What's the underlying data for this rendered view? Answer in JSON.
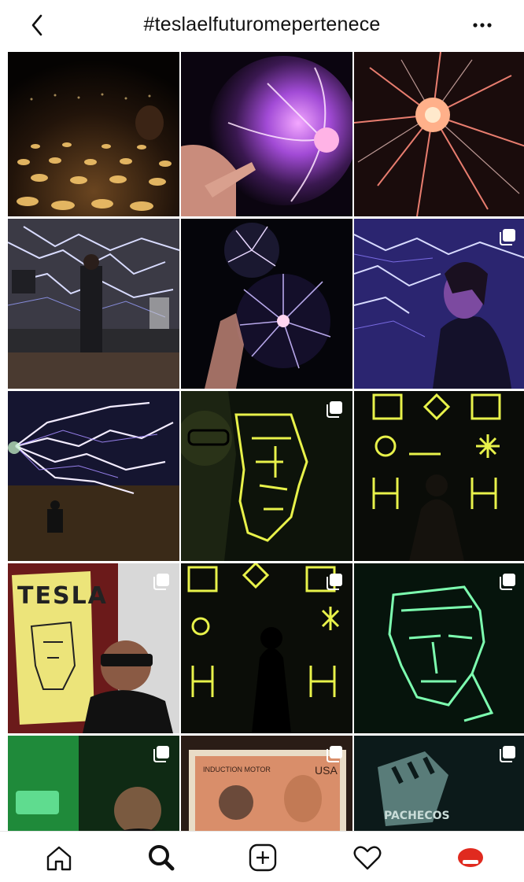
{
  "header": {
    "title": "#teslaelfuturomepertenece",
    "back_icon": "chevron-left-icon",
    "more_icon": "more-horizontal-icon"
  },
  "grid": {
    "posts": [
      {
        "subject": "candles in dark room",
        "multi": false
      },
      {
        "subject": "hand on plasma ball",
        "multi": false
      },
      {
        "subject": "plasma ball red filaments",
        "multi": false
      },
      {
        "subject": "man under tesla coil lightning",
        "multi": false
      },
      {
        "subject": "hands around plasma ball",
        "multi": false
      },
      {
        "subject": "woman under blue lightning",
        "multi": true
      },
      {
        "subject": "lightning over man sitting",
        "multi": false
      },
      {
        "subject": "selfie with neon tesla face",
        "multi": true
      },
      {
        "subject": "neon symbols wall",
        "multi": false
      },
      {
        "subject": "selfie with tesla poster",
        "multi": true,
        "poster_text": "TESLA"
      },
      {
        "subject": "silhouette in neon symbols",
        "multi": true
      },
      {
        "subject": "green neon tesla portrait",
        "multi": true
      },
      {
        "subject": "selfie in green light",
        "multi": true
      },
      {
        "subject": "tesla stamp",
        "multi": true,
        "stamp_text": [
          "INDUCTION MOTOR",
          "USA"
        ]
      },
      {
        "subject": "pachecos logo",
        "multi": true,
        "logo_text": "PACHECOS"
      }
    ]
  },
  "tabbar": {
    "tabs": [
      {
        "icon": "home-icon",
        "active": false
      },
      {
        "icon": "search-icon",
        "active": true
      },
      {
        "icon": "add-post-icon",
        "active": false
      },
      {
        "icon": "heart-icon",
        "active": false
      },
      {
        "icon": "profile-avatar-icon",
        "active": false
      }
    ]
  },
  "colors": {
    "neon_yellow": "#e8f24a",
    "plasma_purple": "#a24bd6",
    "lightning_blue": "#7d86ff",
    "avatar_red": "#e02a1f"
  }
}
